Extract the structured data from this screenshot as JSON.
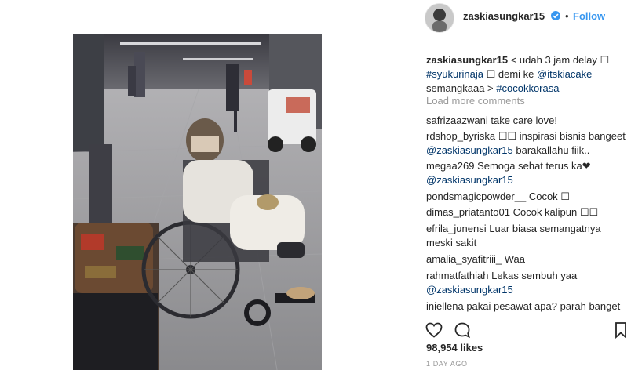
{
  "post": {
    "username": "zaskiasungkar15",
    "follow_label": "Follow",
    "dot": "•",
    "caption": {
      "username": "zaskiasungkar15",
      "line1": "< udah 3 jam delay ",
      "emoji1": "☐",
      "hashtag1": "#syukurinaja",
      "emoji2": "☐",
      "text2": " demi ke ",
      "mention1": "@itskiacake",
      "text3": "semangkaaa > ",
      "hashtag2": "#cocokkorasa"
    },
    "load_more": "Load more comments",
    "comments": [
      {
        "user": "safrizaazwani",
        "text": "take care love!"
      },
      {
        "user": "rdshop_byriska",
        "text": "☐☐ inspirasi bisnis bangeet",
        "mention": "@zaskiasungkar15",
        "text2": "barakallahu fiik.."
      },
      {
        "user": "megaa269",
        "text": "Semoga sehat terus ka❤",
        "mention": "@zaskiasungkar15"
      },
      {
        "user": "pondsmagicpowder__",
        "text": "Cocok ☐"
      },
      {
        "user": "dimas_priatanto01",
        "text": "Cocok kalipun ☐☐"
      },
      {
        "user": "efrila_junensi",
        "text": "Luar biasa semangatnya",
        "text2": "meski sakit"
      },
      {
        "user": "amalia_syafitriii_",
        "text": "Waa"
      },
      {
        "user": "rahmatfathiah",
        "text": "Lekas sembuh yaa",
        "mention": "@zaskiasungkar15"
      },
      {
        "user": "iniellena",
        "text": "pakai pesawat apa? parah banget"
      }
    ],
    "likes": "98,954 likes",
    "time_ago": "1 DAY AGO",
    "icons": {
      "like": "heart-icon",
      "comment": "comment-bubble-icon",
      "save": "bookmark-icon",
      "verified": "verified-badge-icon"
    },
    "colors": {
      "link_blue": "#3897f0",
      "hashtag_blue": "#003569",
      "muted": "#999999"
    }
  }
}
